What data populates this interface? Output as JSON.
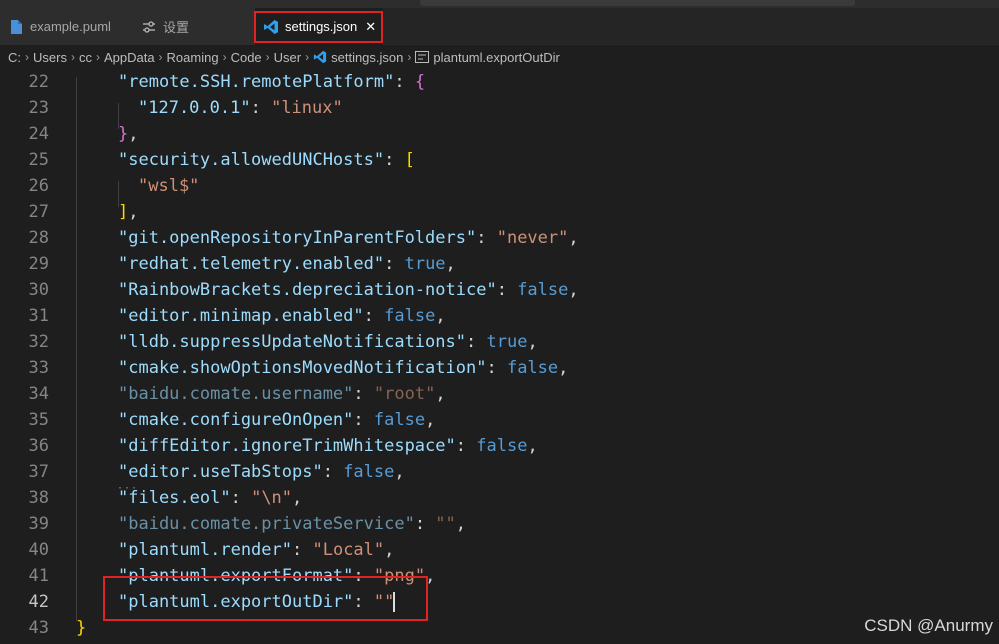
{
  "tabs": [
    {
      "label": "example.puml",
      "icon": "file-icon"
    },
    {
      "label": "设置",
      "icon": "settings-sliders-icon"
    },
    {
      "label": "settings.json",
      "icon": "vscode-icon",
      "close": "✕"
    }
  ],
  "breadcrumb": [
    "C:",
    "Users",
    "cc",
    "AppData",
    "Roaming",
    "Code",
    "User",
    "settings.json",
    "plantuml.exportOutDir"
  ],
  "lines": [
    {
      "n": "22",
      "tokens": [
        [
          "k",
          "\"remote.SSH.remotePlatform\""
        ],
        [
          "p",
          ": "
        ],
        [
          "m",
          "{"
        ]
      ]
    },
    {
      "n": "23",
      "tokens": [
        [
          "k",
          "\"127.0.0.1\""
        ],
        [
          "p",
          ": "
        ],
        [
          "s",
          "\"linux\""
        ]
      ]
    },
    {
      "n": "24",
      "tokens": [
        [
          "m",
          "}"
        ],
        [
          "p",
          ","
        ]
      ]
    },
    {
      "n": "25",
      "tokens": [
        [
          "k",
          "\"security.allowedUNCHosts\""
        ],
        [
          "p",
          ": "
        ],
        [
          "y",
          "["
        ]
      ]
    },
    {
      "n": "26",
      "tokens": [
        [
          "s",
          "\"wsl$\""
        ]
      ]
    },
    {
      "n": "27",
      "tokens": [
        [
          "y",
          "]"
        ],
        [
          "p",
          ","
        ]
      ]
    },
    {
      "n": "28",
      "tokens": [
        [
          "k",
          "\"git.openRepositoryInParentFolders\""
        ],
        [
          "p",
          ": "
        ],
        [
          "s",
          "\"never\""
        ],
        [
          "p",
          ","
        ]
      ]
    },
    {
      "n": "29",
      "tokens": [
        [
          "k",
          "\"redhat.telemetry.enabled\""
        ],
        [
          "p",
          ": "
        ],
        [
          "b",
          "true"
        ],
        [
          "p",
          ","
        ]
      ]
    },
    {
      "n": "30",
      "tokens": [
        [
          "k",
          "\"RainbowBrackets.depreciation-notice\""
        ],
        [
          "p",
          ": "
        ],
        [
          "b",
          "false"
        ],
        [
          "p",
          ","
        ]
      ]
    },
    {
      "n": "31",
      "tokens": [
        [
          "k",
          "\"editor.minimap.enabled\""
        ],
        [
          "p",
          ": "
        ],
        [
          "b",
          "false"
        ],
        [
          "p",
          ","
        ]
      ]
    },
    {
      "n": "32",
      "tokens": [
        [
          "k",
          "\"lldb.suppressUpdateNotifications\""
        ],
        [
          "p",
          ": "
        ],
        [
          "b",
          "true"
        ],
        [
          "p",
          ","
        ]
      ]
    },
    {
      "n": "33",
      "tokens": [
        [
          "k",
          "\"cmake.showOptionsMovedNotification\""
        ],
        [
          "p",
          ": "
        ],
        [
          "b",
          "false"
        ],
        [
          "p",
          ","
        ]
      ]
    },
    {
      "n": "34",
      "dim": true,
      "tokens": [
        [
          "k",
          "\"baidu.comate.username\""
        ],
        [
          "p",
          ": "
        ],
        [
          "s",
          "\"root\""
        ],
        [
          "p",
          ","
        ]
      ]
    },
    {
      "n": "35",
      "tokens": [
        [
          "k",
          "\"cmake.configureOnOpen\""
        ],
        [
          "p",
          ": "
        ],
        [
          "b",
          "false"
        ],
        [
          "p",
          ","
        ]
      ]
    },
    {
      "n": "36",
      "tokens": [
        [
          "k",
          "\"diffEditor.ignoreTrimWhitespace\""
        ],
        [
          "p",
          ": "
        ],
        [
          "b",
          "false"
        ],
        [
          "p",
          ","
        ]
      ]
    },
    {
      "n": "37",
      "tokens": [
        [
          "k",
          "\"editor.useTabStops\""
        ],
        [
          "p",
          ": "
        ],
        [
          "b",
          "false"
        ],
        [
          "p",
          ","
        ]
      ]
    },
    {
      "n": "38",
      "tokens": [
        [
          "k",
          "\"files.eol\""
        ],
        [
          "p",
          ": "
        ],
        [
          "s",
          "\"\\n\""
        ],
        [
          "p",
          ","
        ]
      ]
    },
    {
      "n": "39",
      "dim": true,
      "tokens": [
        [
          "k",
          "\"baidu.comate.privateService\""
        ],
        [
          "p",
          ": "
        ],
        [
          "s",
          "\"\""
        ],
        [
          "p",
          ","
        ]
      ]
    },
    {
      "n": "40",
      "tokens": [
        [
          "k",
          "\"plantuml.render\""
        ],
        [
          "p",
          ": "
        ],
        [
          "s",
          "\"Local\""
        ],
        [
          "p",
          ","
        ]
      ]
    },
    {
      "n": "41",
      "tokens": [
        [
          "k",
          "\"plantuml.exportFormat\""
        ],
        [
          "p",
          ": "
        ],
        [
          "s",
          "\"png\""
        ],
        [
          "p",
          ","
        ]
      ]
    },
    {
      "n": "42",
      "active": true,
      "tokens": [
        [
          "k",
          "\"plantuml.exportOutDir\""
        ],
        [
          "p",
          ": "
        ],
        [
          "s",
          "\"\""
        ]
      ]
    },
    {
      "n": "43",
      "tokens": [
        [
          "y",
          "}"
        ]
      ]
    }
  ],
  "watermark": "CSDN @Anurmy",
  "colors": {
    "accent_highlight": "#e02323",
    "key": "#9cdcfe",
    "string": "#ce9178",
    "boolean": "#569cd6"
  }
}
